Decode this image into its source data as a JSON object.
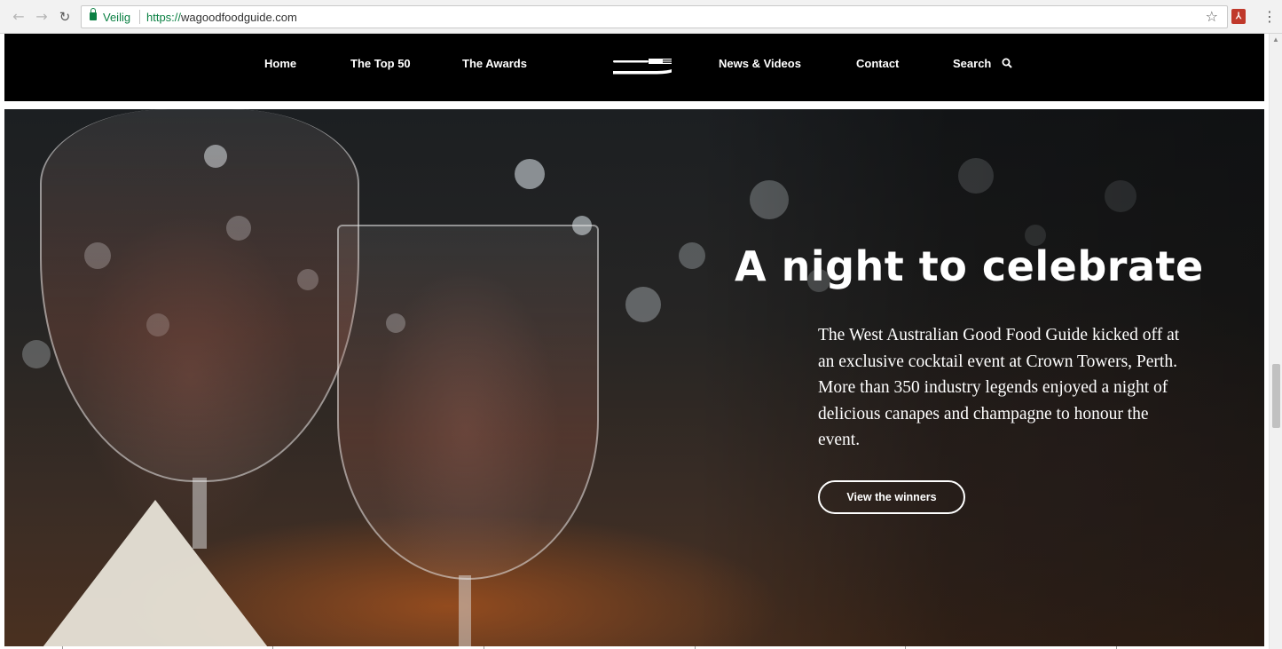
{
  "browser": {
    "secure_label": "Veilig",
    "url_scheme": "https://",
    "url_host": "wagoodfoodguide.com",
    "icons": [
      "back-arrow",
      "forward-arrow",
      "reload",
      "lock",
      "star",
      "pdf-extension",
      "menu-kebab"
    ],
    "colors": {
      "secure": "#0b8043"
    }
  },
  "site_nav": {
    "items": [
      {
        "label": "Home"
      },
      {
        "label": "The Top 50"
      },
      {
        "label": "The Awards"
      },
      {
        "label": "News & Videos"
      },
      {
        "label": "Contact"
      },
      {
        "label": "Search"
      }
    ],
    "logo": "cutlery-logo",
    "background": "#000000"
  },
  "hero": {
    "title": "A night to celebrate",
    "body": "The West Australian Good Food Guide kicked off at an exclusive cocktail event at Crown Towers, Perth. More than 350 industry legends enjoyed a night of delicious canapes and champagne to honour the event.",
    "button_label": "View the winners"
  }
}
